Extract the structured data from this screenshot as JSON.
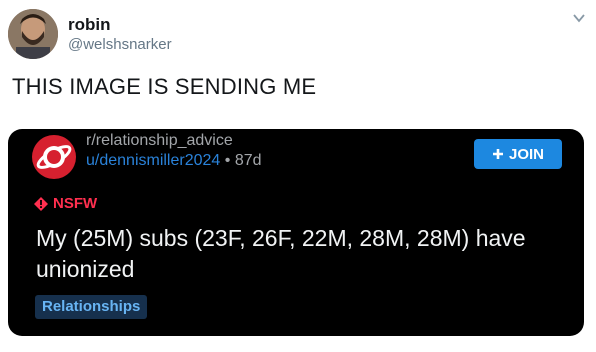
{
  "tweet": {
    "display_name": "robin",
    "handle": "@welshsnarker",
    "text": "THIS IMAGE IS SENDING ME",
    "menu_icon": "chevron-down-icon"
  },
  "embed": {
    "subreddit": "r/relationship_advice",
    "user": "u/dennismiller2024",
    "age": "87d",
    "join_label": "JOIN",
    "nsfw_label": "NSFW",
    "post_title": "My (25M) subs (23F, 26F, 22M, 28M, 28M) have unionized",
    "flair": "Relationships",
    "colors": {
      "card_bg": "#000000",
      "subreddit_icon": "#d6202f",
      "join_button": "#1d88e0",
      "nsfw": "#ff2f4f",
      "username": "#2a82d9",
      "flair_bg": "#16304d",
      "flair_text": "#68b4f3"
    }
  }
}
